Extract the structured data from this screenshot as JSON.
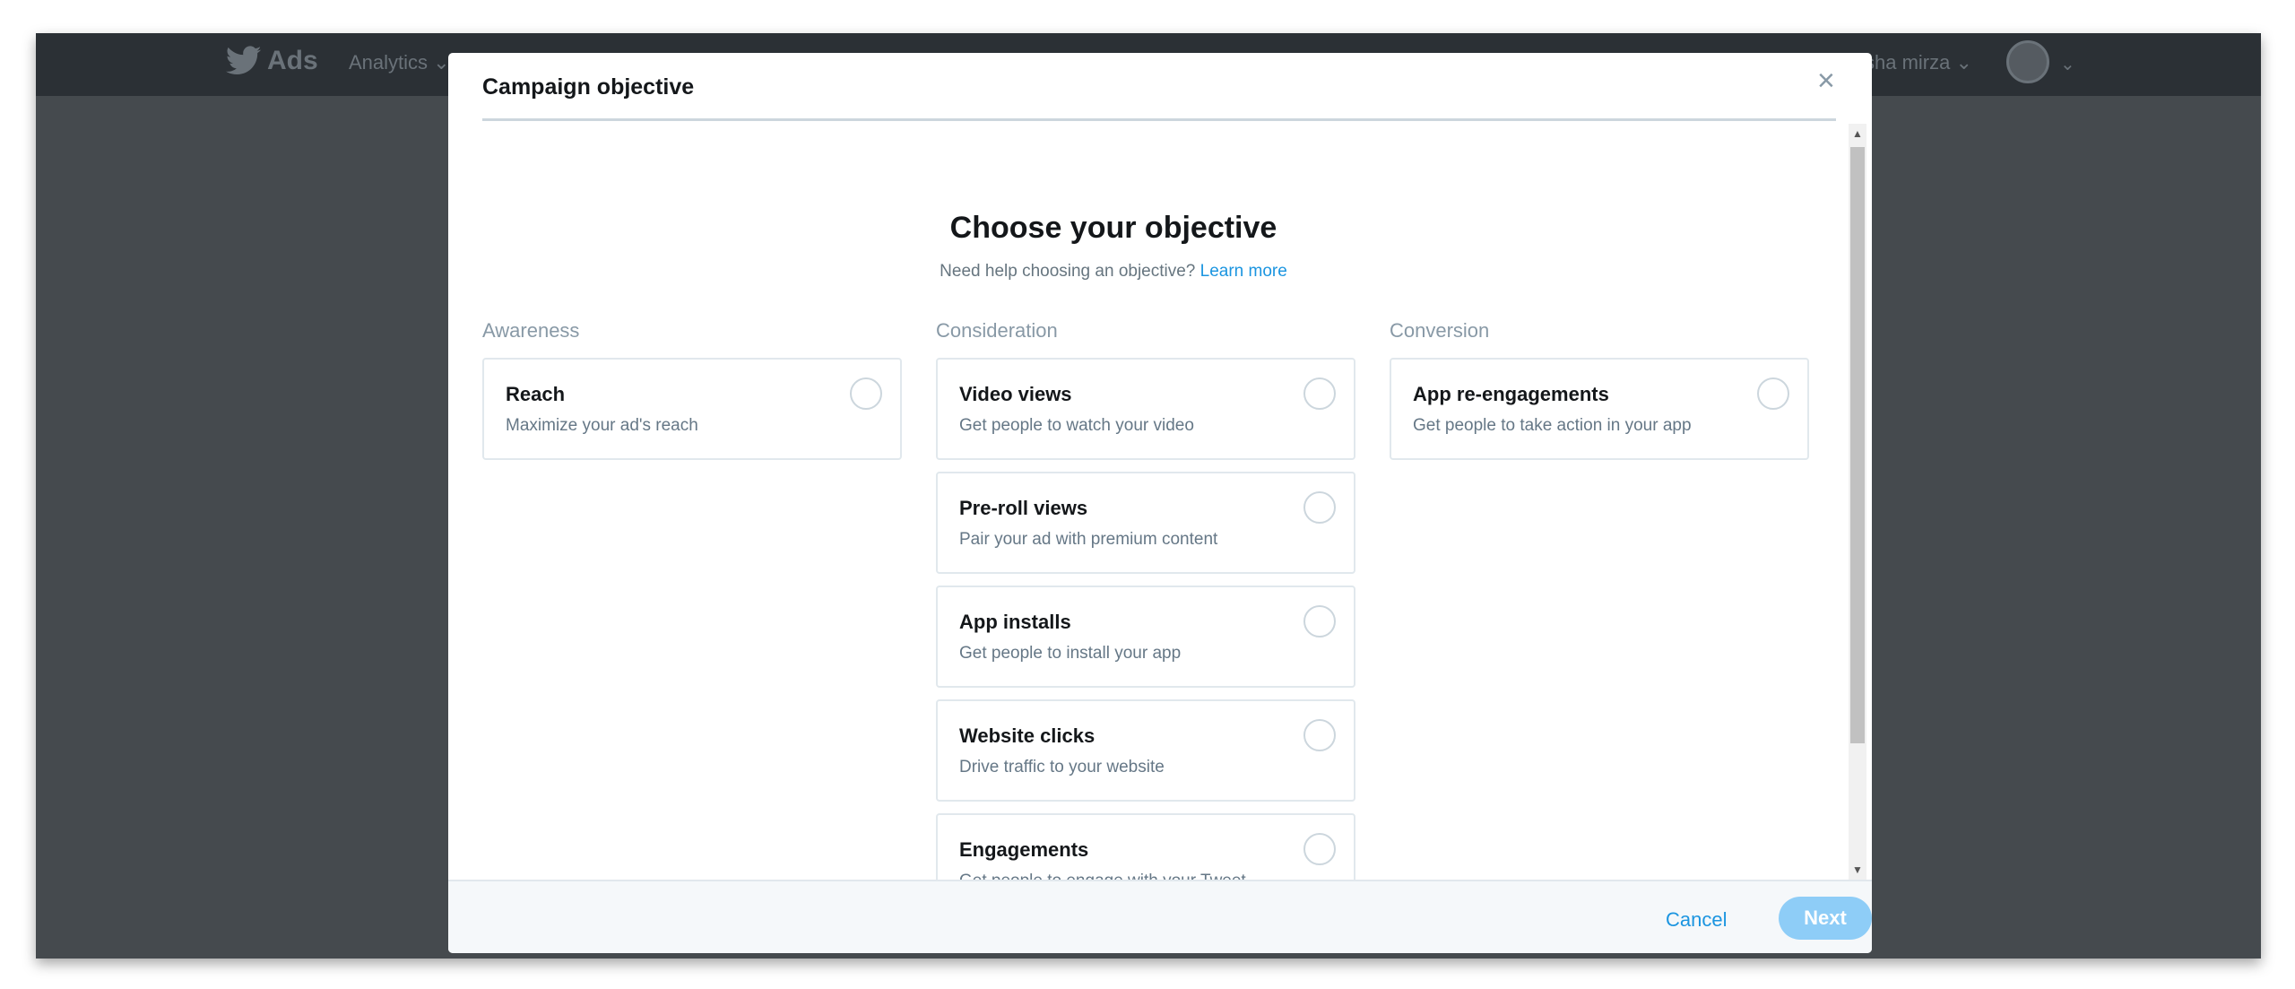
{
  "topbar": {
    "brand": "Ads",
    "analytics": "Analytics ⌄",
    "user": "sha mirza ⌄",
    "avatar_chevron": "⌄"
  },
  "modal": {
    "title": "Campaign objective",
    "close": "×",
    "heading": "Choose your objective",
    "help_text": "Need help choosing an objective? ",
    "learn_more": "Learn more"
  },
  "columns": [
    {
      "label": "Awareness",
      "cards": [
        {
          "title": "Reach",
          "desc": "Maximize your ad's reach"
        }
      ]
    },
    {
      "label": "Consideration",
      "cards": [
        {
          "title": "Video views",
          "desc": "Get people to watch your video"
        },
        {
          "title": "Pre-roll views",
          "desc": "Pair your ad with premium content"
        },
        {
          "title": "App installs",
          "desc": "Get people to install your app"
        },
        {
          "title": "Website clicks",
          "desc": "Drive traffic to your website"
        },
        {
          "title": "Engagements",
          "desc": "Get people to engage with your Tweet"
        }
      ]
    },
    {
      "label": "Conversion",
      "cards": [
        {
          "title": "App re-engagements",
          "desc": "Get people to take action in your app"
        }
      ]
    }
  ],
  "footer": {
    "cancel": "Cancel",
    "next": "Next"
  },
  "scrollbar": {
    "up": "▲",
    "down": "▼"
  },
  "colors": {
    "accent": "#1b95e0",
    "next_disabled": "#8ecdf7",
    "backdrop": "#454a4e",
    "topbar": "#2b3035"
  }
}
